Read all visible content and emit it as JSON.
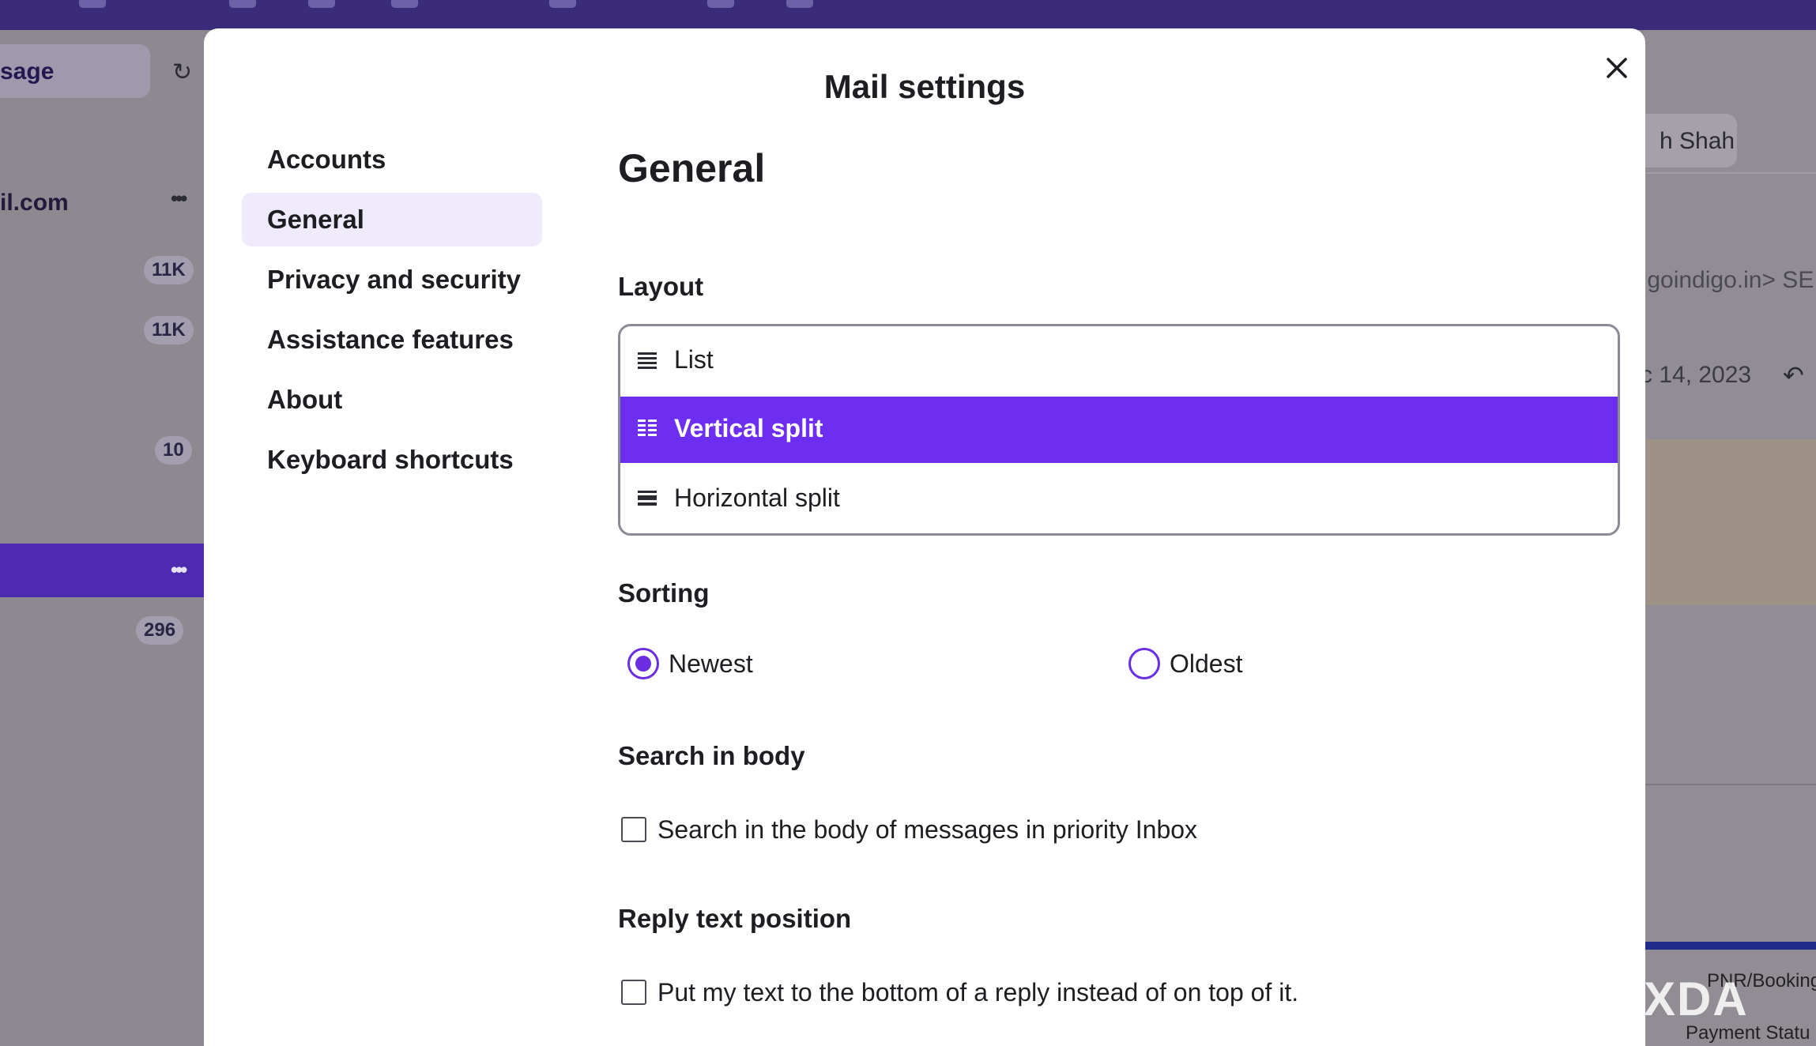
{
  "background": {
    "compose_label": "sage",
    "account_label": "il.com",
    "folder_counts": [
      "11K",
      "11K",
      "10",
      "296"
    ],
    "user_name": "h Shah",
    "email_snippet": ".goindigo.in> SE",
    "date_snippet": "c 14, 2023",
    "pnr_text": "PNR/Booking",
    "payment_text": "Payment Statu",
    "watermark_left": "[",
    "watermark_right": "XDA"
  },
  "modal": {
    "title": "Mail settings",
    "close_icon": "close-icon",
    "nav": [
      {
        "label": "Accounts",
        "selected": false
      },
      {
        "label": "General",
        "selected": true
      },
      {
        "label": "Privacy and security",
        "selected": false
      },
      {
        "label": "Assistance features",
        "selected": false
      },
      {
        "label": "About",
        "selected": false
      },
      {
        "label": "Keyboard shortcuts",
        "selected": false
      }
    ],
    "section_title": "General",
    "layout": {
      "label": "Layout",
      "options": [
        {
          "label": "List",
          "icon": "list-layout-icon",
          "selected": false
        },
        {
          "label": "Vertical split",
          "icon": "vertical-split-icon",
          "selected": true
        },
        {
          "label": "Horizontal split",
          "icon": "horizontal-split-icon",
          "selected": false
        }
      ]
    },
    "sorting": {
      "label": "Sorting",
      "options": [
        {
          "label": "Newest",
          "checked": true
        },
        {
          "label": "Oldest",
          "checked": false
        }
      ]
    },
    "search_in_body": {
      "label": "Search in body",
      "checkbox_label": "Search in the body of messages in priority Inbox",
      "checked": false
    },
    "reply_text_position": {
      "label": "Reply text position",
      "checkbox_label": "Put my text to the bottom of a reply instead of on top of it.",
      "checked": false
    }
  },
  "colors": {
    "accent": "#6d2ef2",
    "nav_selected_bg": "#efeafc",
    "radio": "#6a2de0"
  }
}
